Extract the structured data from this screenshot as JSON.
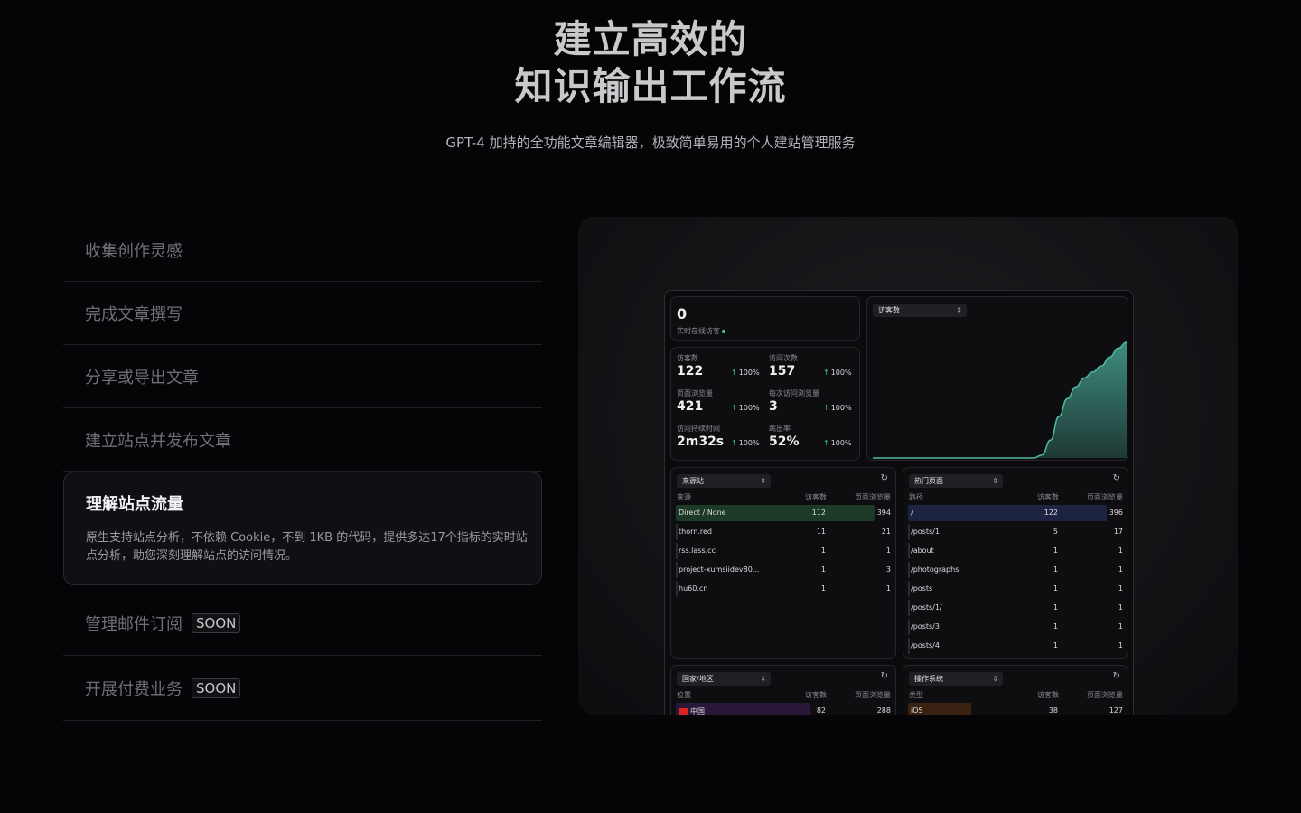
{
  "hero": {
    "title_line1": "建立高效的",
    "title_line2": "知识输出工作流",
    "subtitle": "GPT-4 加持的全功能文章编辑器，极致简单易用的个人建站管理服务"
  },
  "features": [
    {
      "label": "收集创作灵感"
    },
    {
      "label": "完成文章撰写"
    },
    {
      "label": "分享或导出文章"
    },
    {
      "label": "建立站点并发布文章"
    },
    {
      "label": "理解站点流量",
      "description": "原生支持站点分析，不依赖 Cookie，不到 1KB 的代码，提供多达17个指标的实时站点分析，助您深刻理解站点的访问情况。"
    },
    {
      "label": "管理邮件订阅",
      "badge": "SOON"
    },
    {
      "label": "开展付费业务",
      "badge": "SOON"
    }
  ],
  "dashboard": {
    "realtime": {
      "value": "0",
      "label": "实时在线访客"
    },
    "stats": [
      {
        "label": "访客数",
        "value": "122",
        "change": "100%"
      },
      {
        "label": "访问次数",
        "value": "157",
        "change": "100%"
      },
      {
        "label": "页面浏览量",
        "value": "421",
        "change": "100%"
      },
      {
        "label": "每次访问浏览量",
        "value": "3",
        "change": "100%"
      },
      {
        "label": "访问持续时间",
        "value": "2m32s",
        "change": "100%"
      },
      {
        "label": "跳出率",
        "value": "52%",
        "change": "100%"
      }
    ],
    "chart_select": "访客数",
    "chart_data": {
      "type": "area",
      "x": [
        0,
        1,
        2,
        3,
        4,
        5,
        6,
        7,
        8,
        9,
        10,
        11,
        12,
        13,
        14,
        15,
        16,
        17,
        18,
        19,
        20,
        21,
        22,
        23,
        24,
        25,
        26,
        27,
        28,
        29,
        30
      ],
      "values": [
        0,
        0,
        0,
        0,
        0,
        0,
        0,
        0,
        0,
        0,
        0,
        0,
        0,
        0,
        0,
        0,
        0,
        0,
        0,
        0,
        1,
        6,
        14,
        20,
        24,
        27,
        29,
        31,
        34,
        37,
        39
      ],
      "title": "",
      "xlabel": "",
      "ylabel": "",
      "grid": false,
      "color": "#4fb8a2"
    },
    "referrers": {
      "select": "来源站",
      "columns": [
        "来源",
        "访客数",
        "页面浏览量"
      ],
      "rows": [
        {
          "name": "Direct / None",
          "visitors": "112",
          "views": "394",
          "share": 1.0
        },
        {
          "name": "thorn.red",
          "visitors": "11",
          "views": "21",
          "share": 0
        },
        {
          "name": "rss.lass.cc",
          "visitors": "1",
          "views": "1",
          "share": 0
        },
        {
          "name": "project-xumsiidev80...",
          "visitors": "1",
          "views": "3",
          "share": 0
        },
        {
          "name": "hu60.cn",
          "visitors": "1",
          "views": "1",
          "share": 0
        }
      ],
      "bar_color": "#1c3a25"
    },
    "pages": {
      "select": "热门页面",
      "columns": [
        "路径",
        "访客数",
        "页面浏览量"
      ],
      "rows": [
        {
          "name": "/",
          "visitors": "122",
          "views": "396",
          "share": 1.0
        },
        {
          "name": "/posts/1",
          "visitors": "5",
          "views": "17",
          "share": 0
        },
        {
          "name": "/about",
          "visitors": "1",
          "views": "1",
          "share": 0
        },
        {
          "name": "/photographs",
          "visitors": "1",
          "views": "1",
          "share": 0
        },
        {
          "name": "/posts",
          "visitors": "1",
          "views": "1",
          "share": 0
        },
        {
          "name": "/posts/1/",
          "visitors": "1",
          "views": "1",
          "share": 0
        },
        {
          "name": "/posts/3",
          "visitors": "1",
          "views": "1",
          "share": 0
        },
        {
          "name": "/posts/4",
          "visitors": "1",
          "views": "1",
          "share": 0
        }
      ],
      "bar_color": "#1d2442"
    },
    "countries": {
      "select": "国家/地区",
      "columns": [
        "位置",
        "访客数",
        "页面浏览量"
      ],
      "rows": [
        {
          "name": "中国",
          "visitors": "82",
          "views": "288",
          "share": 0.67
        }
      ],
      "bar_color": "#2a1838"
    },
    "os": {
      "select": "操作系统",
      "columns": [
        "类型",
        "访客数",
        "页面浏览量"
      ],
      "rows": [
        {
          "name": "iOS",
          "visitors": "38",
          "views": "127",
          "share": 0.31
        }
      ],
      "bar_color": "#3a2212"
    }
  }
}
